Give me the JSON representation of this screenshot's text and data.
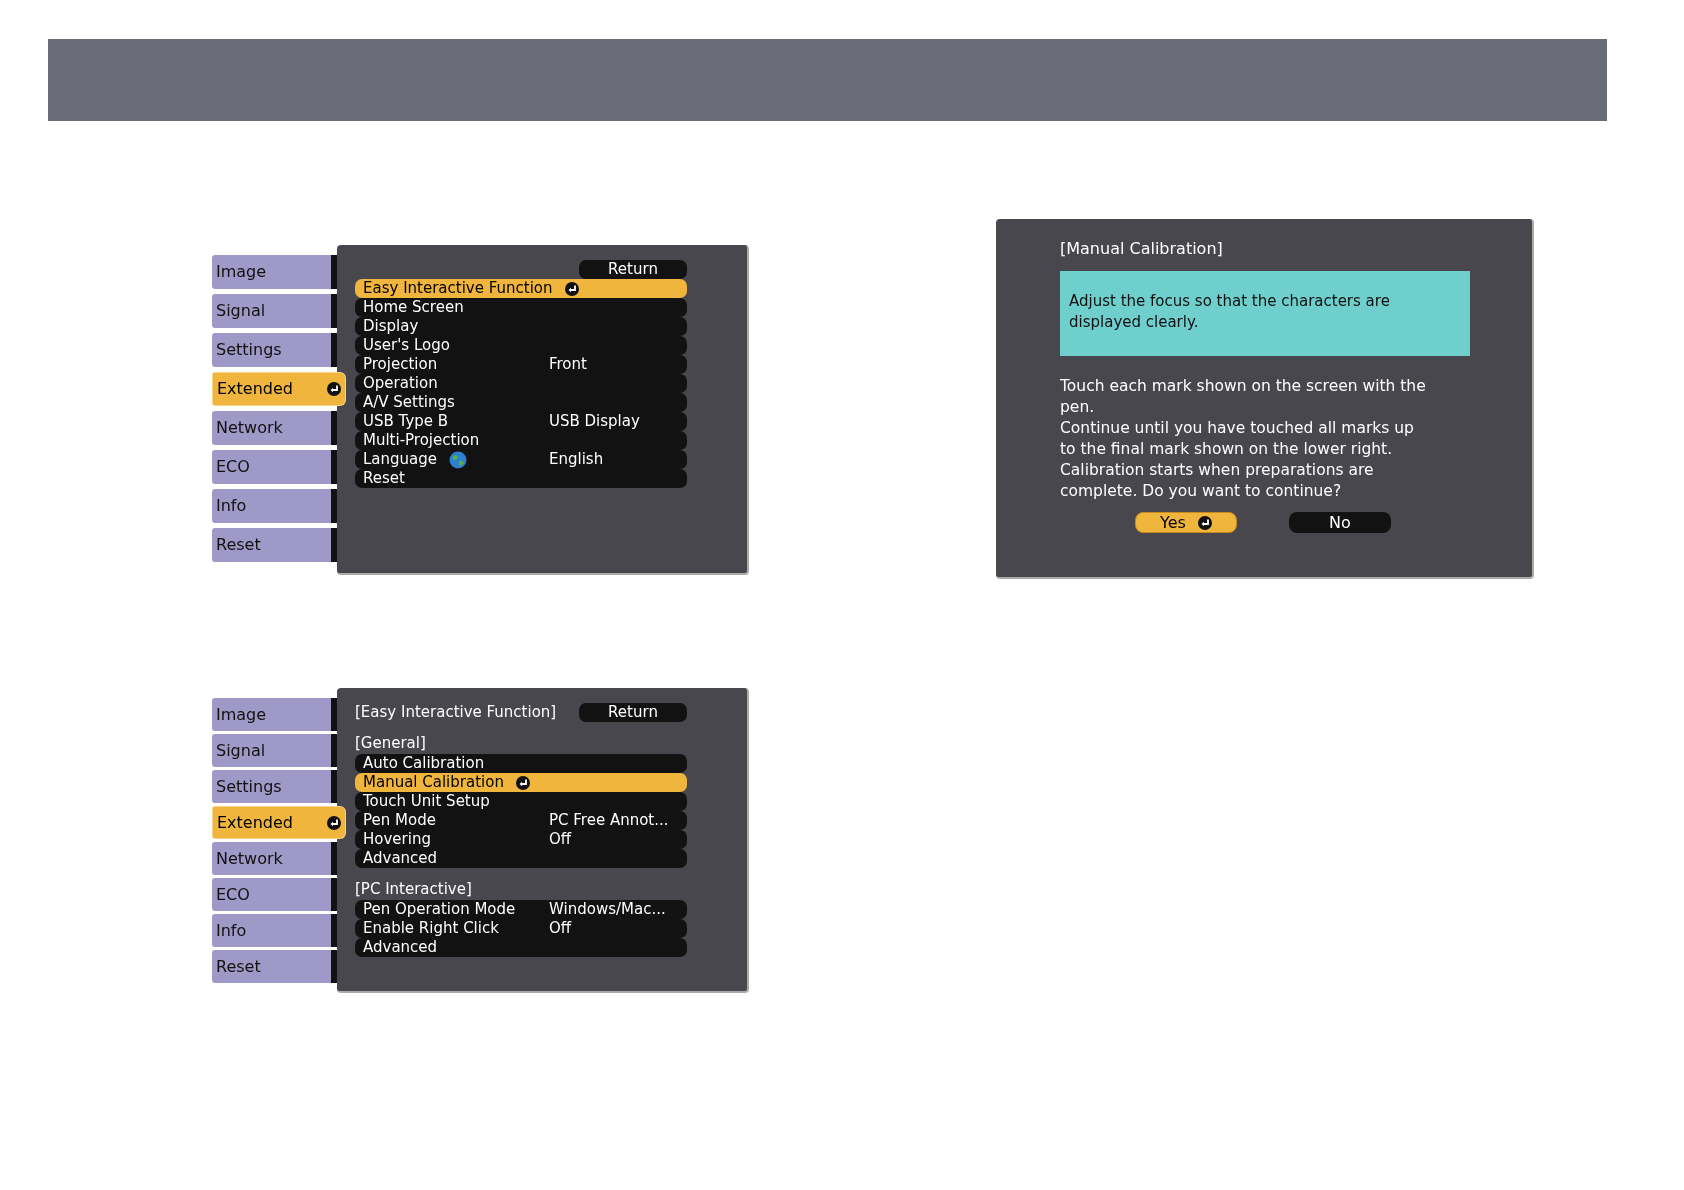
{
  "menus": [
    {
      "tabs": [
        {
          "label": "Image",
          "selected": false
        },
        {
          "label": "Signal",
          "selected": false
        },
        {
          "label": "Settings",
          "selected": false
        },
        {
          "label": "Extended",
          "selected": true
        },
        {
          "label": "Network",
          "selected": false
        },
        {
          "label": "ECO",
          "selected": false
        },
        {
          "label": "Info",
          "selected": false
        },
        {
          "label": "Reset",
          "selected": false
        }
      ],
      "return_label": "Return",
      "sections": [
        {
          "rows": [
            {
              "label": "Easy Interactive Function",
              "selected": true,
              "kind": "item"
            },
            {
              "label": "Home Screen",
              "selected": false,
              "kind": "item"
            },
            {
              "label": "Display",
              "selected": false,
              "kind": "item"
            },
            {
              "label": "User's Logo",
              "selected": false,
              "kind": "item"
            },
            {
              "label": "Projection",
              "value": "Front",
              "selected": false,
              "kind": "item"
            },
            {
              "label": "Operation",
              "selected": false,
              "kind": "item"
            },
            {
              "label": "A/V Settings",
              "selected": false,
              "kind": "item"
            },
            {
              "label": "USB Type B",
              "value": "USB Display",
              "selected": false,
              "kind": "item"
            },
            {
              "label": "Multi-Projection",
              "selected": false,
              "kind": "item"
            },
            {
              "label": "Language",
              "value": "English",
              "selected": false,
              "kind": "language"
            },
            {
              "label": "Reset",
              "selected": false,
              "kind": "item"
            }
          ]
        }
      ]
    },
    {
      "tabs": [
        {
          "label": "Image",
          "selected": false
        },
        {
          "label": "Signal",
          "selected": false
        },
        {
          "label": "Settings",
          "selected": false
        },
        {
          "label": "Extended",
          "selected": true
        },
        {
          "label": "Network",
          "selected": false
        },
        {
          "label": "ECO",
          "selected": false
        },
        {
          "label": "Info",
          "selected": false
        },
        {
          "label": "Reset",
          "selected": false
        }
      ],
      "title": "[Easy Interactive Function]",
      "return_label": "Return",
      "sections": [
        {
          "heading": "[General]",
          "rows": [
            {
              "label": "Auto Calibration",
              "selected": false,
              "kind": "item"
            },
            {
              "label": "Manual Calibration",
              "selected": true,
              "kind": "item"
            },
            {
              "label": "Touch Unit Setup",
              "selected": false,
              "kind": "item"
            },
            {
              "label": "Pen Mode",
              "value": "PC Free Annot...",
              "selected": false,
              "kind": "item"
            },
            {
              "label": "Hovering",
              "value": "Off",
              "selected": false,
              "kind": "item"
            },
            {
              "label": "Advanced",
              "selected": false,
              "kind": "item"
            }
          ]
        },
        {
          "heading": "[PC Interactive]",
          "rows": [
            {
              "label": "Pen Operation Mode",
              "value": "Windows/Mac...",
              "selected": false,
              "kind": "item"
            },
            {
              "label": "Enable Right Click",
              "value": "Off",
              "selected": false,
              "kind": "item"
            },
            {
              "label": "Advanced",
              "selected": false,
              "kind": "item"
            }
          ]
        }
      ]
    }
  ],
  "dialog": {
    "title": "[Manual Calibration]",
    "notice": "Adjust the focus so that the characters are displayed clearly.",
    "message_lines": [
      "Touch each mark shown on the screen with the",
      "pen.",
      "Continue until you have touched all marks up",
      "to the final mark shown on the lower right.",
      "Calibration starts when preparations are",
      "complete. Do you want to continue?"
    ],
    "buttons": [
      {
        "label": "Yes",
        "selected": true
      },
      {
        "label": "No",
        "selected": false
      }
    ]
  }
}
